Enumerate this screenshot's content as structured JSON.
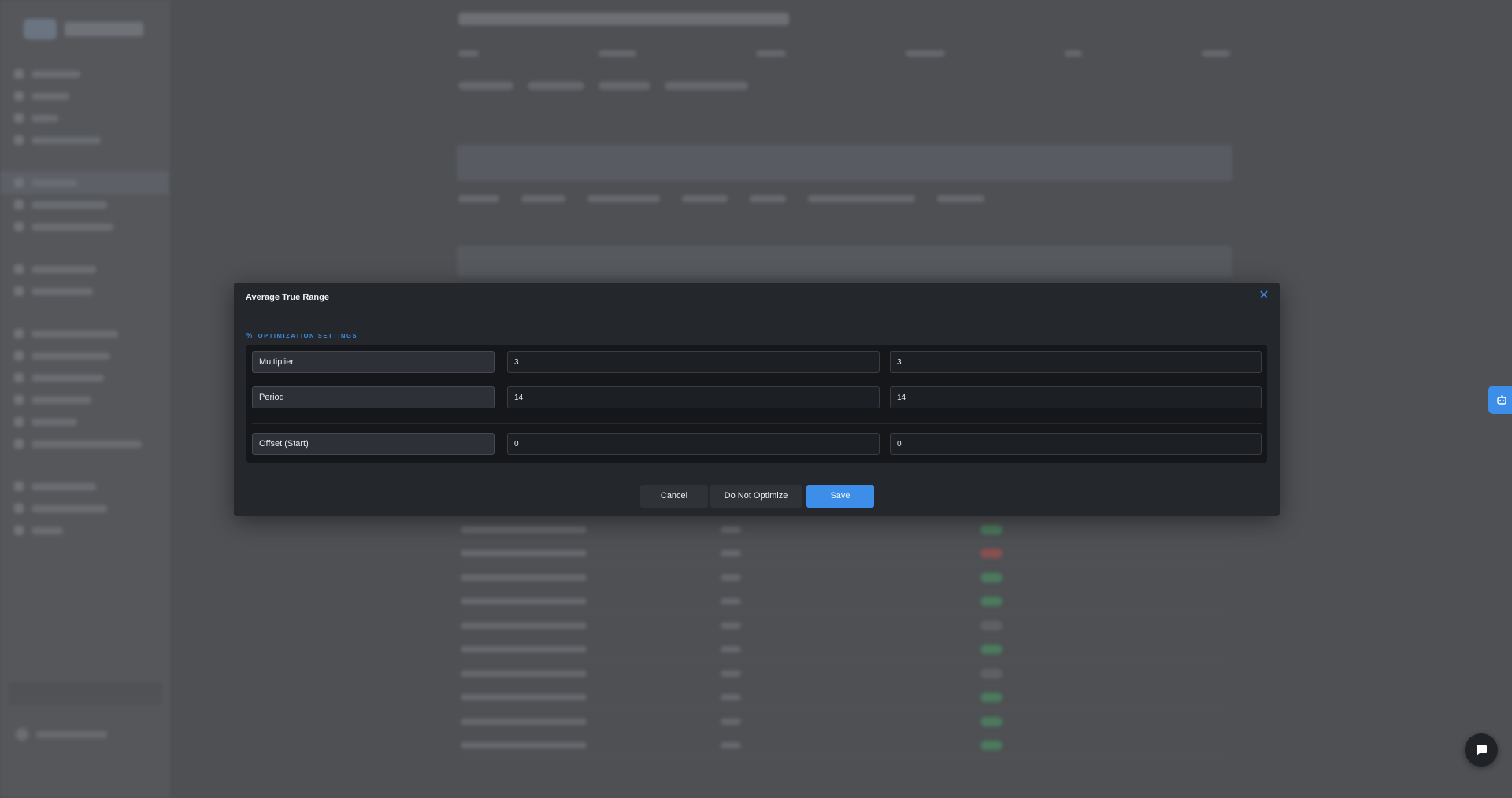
{
  "modal": {
    "title": "Average True Range",
    "close_icon": "close-icon",
    "section_label": "OPTIMIZATION SETTINGS",
    "section_icon": "percent-icon",
    "rows": [
      {
        "label": "Multiplier",
        "min": "3",
        "max": "3"
      },
      {
        "label": "Period",
        "min": "14",
        "max": "14"
      },
      {
        "label": "Offset (Start)",
        "min": "0",
        "max": "0"
      }
    ],
    "buttons": {
      "cancel": "Cancel",
      "do_not_optimize": "Do Not Optimize",
      "save": "Save"
    }
  },
  "floating": {
    "assistant_icon": "robot-icon",
    "chat_icon": "chat-bubble-icon"
  },
  "colors": {
    "accent": "#3d8ee8",
    "modal_bg": "#24272c",
    "overlay": "#4e5054"
  }
}
